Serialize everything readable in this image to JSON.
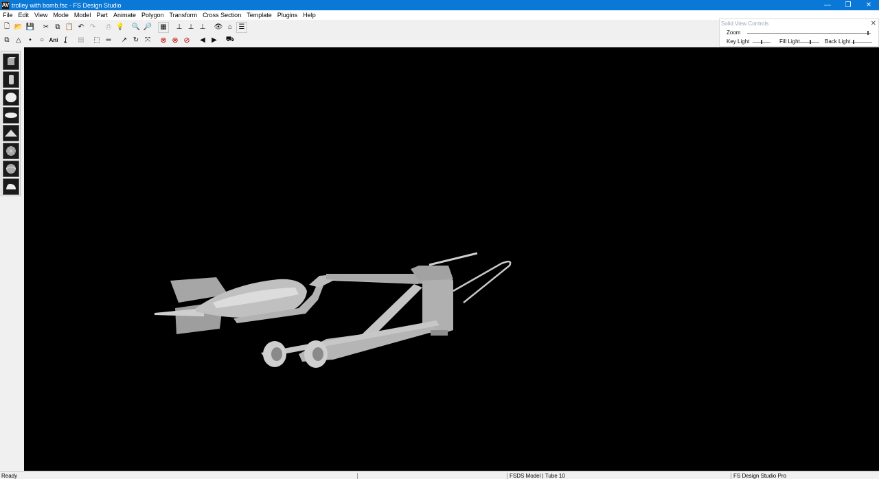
{
  "window": {
    "title": "trolley with bomb.fsc - FS Design Studio",
    "app_icon_text": "AV",
    "minimize": "—",
    "restore": "❐",
    "close": "✕"
  },
  "menu": [
    "File",
    "Edit",
    "View",
    "Mode",
    "Model",
    "Part",
    "Animate",
    "Polygon",
    "Transform",
    "Cross Section",
    "Template",
    "Plugins",
    "Help"
  ],
  "toolbar_text": {
    "ani": "Ani"
  },
  "solid_view_controls": {
    "title": "Solid View Controls",
    "close": "✕",
    "zoom": "Zoom",
    "key_light": "Key Light",
    "fill_light": "Fill Light",
    "back_light": "Back Light",
    "zoom_level": 0.98,
    "key_light_level": 0.5,
    "fill_light_level": 0.55,
    "back_light_level": 0.1
  },
  "status": {
    "ready": "Ready",
    "model_info": "FSDS Model | Tube 10",
    "edition": "FS Design Studio Pro"
  },
  "colors": {
    "titlebar": "#0a78d7",
    "viewport_bg": "#000000",
    "model_gray": "#bcbcbc"
  }
}
